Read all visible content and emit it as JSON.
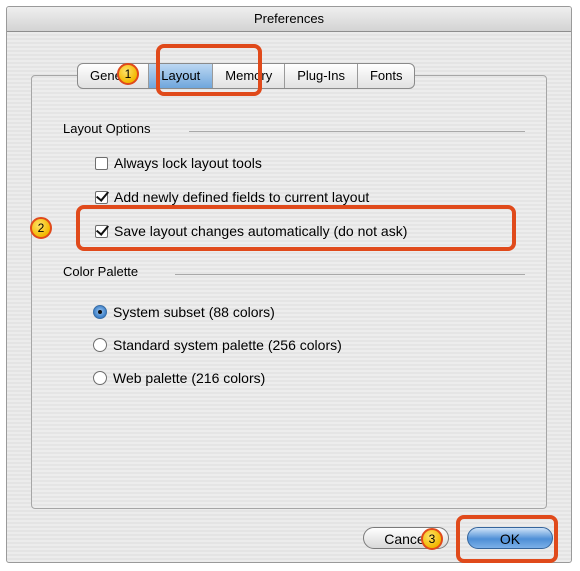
{
  "window": {
    "title": "Preferences"
  },
  "tabs": [
    {
      "label": "General"
    },
    {
      "label": "Layout"
    },
    {
      "label": "Memory"
    },
    {
      "label": "Plug-Ins"
    },
    {
      "label": "Fonts"
    }
  ],
  "selected_tab": "Layout",
  "layout_options": {
    "title": "Layout Options",
    "items": [
      {
        "label": "Always lock layout tools",
        "checked": false
      },
      {
        "label": "Add newly defined fields to current layout",
        "checked": true
      },
      {
        "label": "Save layout changes automatically (do not ask)",
        "checked": true
      }
    ]
  },
  "color_palette": {
    "title": "Color Palette",
    "options": [
      {
        "label": "System subset (88 colors)",
        "selected": true
      },
      {
        "label": "Standard system palette (256 colors)",
        "selected": false
      },
      {
        "label": "Web palette (216 colors)",
        "selected": false
      }
    ]
  },
  "buttons": {
    "cancel": "Cancel",
    "ok": "OK"
  },
  "callouts": {
    "one": "1",
    "two": "2",
    "three": "3"
  },
  "colors": {
    "highlight": "#e04a1b",
    "badge": "#f2b800",
    "selected_tab": "#6fa6dc"
  }
}
